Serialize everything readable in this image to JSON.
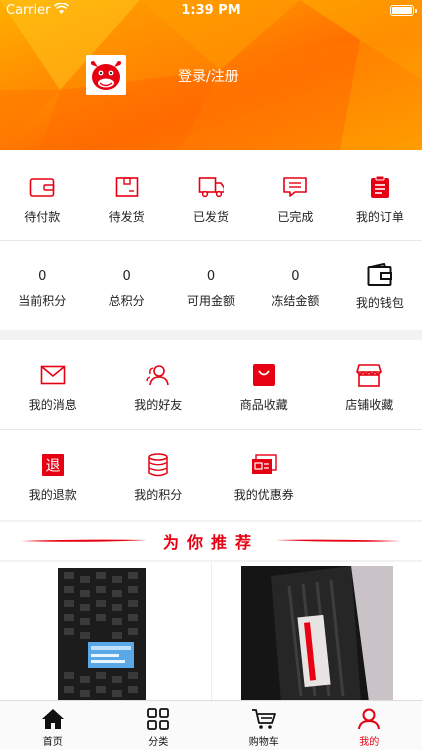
{
  "status_bar": {
    "carrier": "Carrier",
    "time": "1:39 PM"
  },
  "header": {
    "login_label": "登录/注册",
    "avatar_icon": "cow-logo-icon"
  },
  "orders": [
    {
      "label": "待付款",
      "icon": "wallet-card-icon"
    },
    {
      "label": "待发货",
      "icon": "package-box-icon"
    },
    {
      "label": "已发货",
      "icon": "truck-icon"
    },
    {
      "label": "已完成",
      "icon": "completed-message-icon"
    },
    {
      "label": "我的订单",
      "icon": "clipboard-order-icon"
    }
  ],
  "assets": [
    {
      "value": "0",
      "label": "当前积分"
    },
    {
      "value": "0",
      "label": "总积分"
    },
    {
      "value": "0",
      "label": "可用金额"
    },
    {
      "value": "0",
      "label": "冻结金额"
    },
    {
      "value": "",
      "label": "我的钱包",
      "icon": "wallet-icon"
    }
  ],
  "services_row1": [
    {
      "label": "我的消息",
      "icon": "envelope-icon"
    },
    {
      "label": "我的好友",
      "icon": "friends-icon"
    },
    {
      "label": "商品收藏",
      "icon": "shopping-bag-icon"
    },
    {
      "label": "店铺收藏",
      "icon": "storefront-icon"
    }
  ],
  "services_row2": [
    {
      "label": "我的退款",
      "icon": "refund-icon",
      "glyph": "退"
    },
    {
      "label": "我的积分",
      "icon": "coins-stack-icon"
    },
    {
      "label": "我的优惠券",
      "icon": "coupon-icon"
    }
  ],
  "recommend": {
    "title": "为你推荐"
  },
  "tabbar": [
    {
      "label": "首页",
      "icon": "home-icon"
    },
    {
      "label": "分类",
      "icon": "grid-icon"
    },
    {
      "label": "购物车",
      "icon": "cart-icon"
    },
    {
      "label": "我的",
      "icon": "person-icon"
    }
  ],
  "active_tab": "我的",
  "colors": {
    "accent": "#e60012",
    "header_orange": "#ff8a00"
  }
}
